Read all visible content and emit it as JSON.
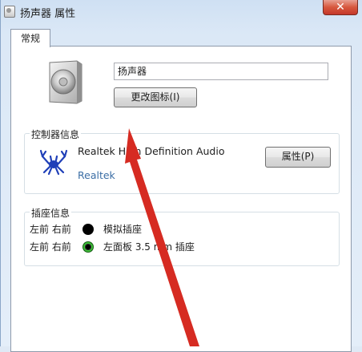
{
  "window": {
    "title": "扬声器 属性",
    "close_glyph": "✕"
  },
  "tabs": [
    {
      "label": "常规",
      "selected": true
    }
  ],
  "general": {
    "device_name_value": "扬声器",
    "change_icon_label": "更改图标(I)"
  },
  "controller": {
    "group_title": "控制器信息",
    "device_name": "Realtek High Definition Audio",
    "vendor": "Realtek",
    "properties_label": "属性(P)",
    "logo_icon": "realtek-crab-logo"
  },
  "jacks": {
    "group_title": "插座信息",
    "rows": [
      {
        "position": "左前 右前",
        "color": "#000000",
        "description": "模拟插座"
      },
      {
        "position": "左前 右前",
        "color": "#3fbf3a",
        "description": "左面板 3.5 mm 插座"
      }
    ]
  },
  "annotation": {
    "arrow_color": "#d62b22"
  }
}
